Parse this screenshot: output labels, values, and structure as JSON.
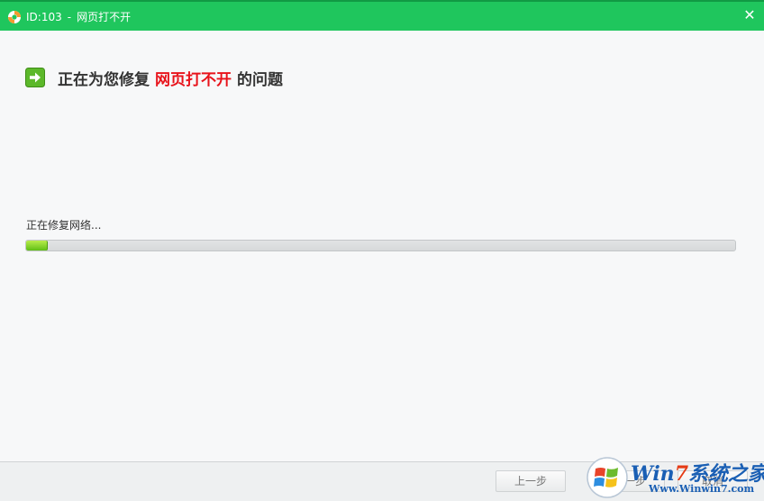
{
  "window": {
    "id_label": "ID:103",
    "separator": "-",
    "title": "网页打不开",
    "close_glyph": "✕",
    "accent_color": "#1fc65d"
  },
  "heading": {
    "prefix": "正在为您修复",
    "highlight": "网页打不开",
    "suffix": "的问题",
    "highlight_color": "#e8131b"
  },
  "progress": {
    "status": "正在修复网络...",
    "fraction": 0.03
  },
  "footer": {
    "prev_label": "上一步",
    "next_label": "下一步",
    "cancel_label": "取消"
  },
  "watermark": {
    "brand_win": "Win",
    "brand_seven": "7",
    "brand_cn": "系统之家",
    "url": "Www.Winwin7.com"
  },
  "icons": {
    "app": "lifebuoy-icon",
    "heading": "arrow-right-icon",
    "close": "close-icon"
  }
}
